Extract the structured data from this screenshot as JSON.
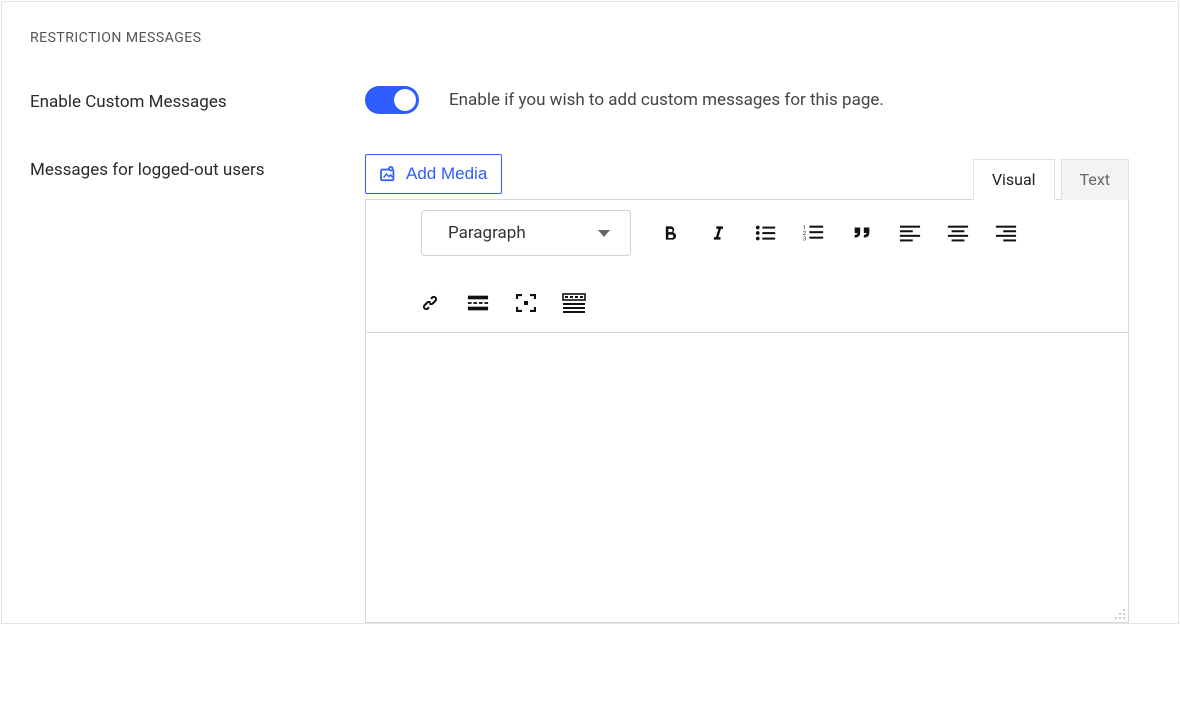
{
  "section_title": "RESTRICTION MESSAGES",
  "enable_custom": {
    "label": "Enable Custom Messages",
    "enabled": true,
    "description": "Enable if you wish to add custom messages for this page."
  },
  "logged_out": {
    "label": "Messages for logged-out users"
  },
  "editor": {
    "add_media_label": "Add Media",
    "tabs": {
      "visual": "Visual",
      "text": "Text",
      "active": "visual"
    },
    "format_label": "Paragraph",
    "content": ""
  }
}
